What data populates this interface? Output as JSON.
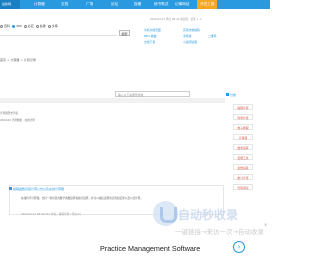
{
  "nav": {
    "logo": "最新网",
    "items": [
      "计算器",
      "文档",
      "广场",
      "论坛",
      "投稿",
      "秘书笔试",
      "记事网站",
      "开发工具"
    ]
  },
  "search": {
    "options": [
      "百科",
      "360",
      "必应",
      "谷歌",
      "文库"
    ],
    "selected_index": 1,
    "button": "搜索"
  },
  "header": {
    "userline": "2020-04-12 周日 08:40  欢迎您：某某  +  ×",
    "links": [
      "手机文档页面",
      "实用文档编辑",
      "MP3 歌曲",
      "手机版",
      "文档下载",
      "小说阅读器",
      "二维码"
    ]
  },
  "breadcrumb": "首页 > 计算器 > 计算记录",
  "main_input_placeholder": "输入以下关键字查询",
  "faint_lines": [
    "计算器历史列表",
    "2020-04 计算数据 · 在线计算"
  ],
  "sidebar": {
    "heading": "分类",
    "items": [
      "编程计算",
      "科学计算",
      "电子教程",
      "计算器",
      "数学运算",
      "宝图工具",
      "复数运算",
      "统计计算",
      "代码调试"
    ]
  },
  "card": {
    "title": "编程函数高级计算公式以及在线计算器",
    "desc": "在线科学计算器，支持一些常见的数学函数运算和统计运算，并可以输出运算的过程和结果以及公式计算。",
    "meta": "2020-04-12 08:40:33 | 作者：编程计算 | 评论(0)"
  },
  "ad": {
    "title": "Practice Management Software",
    "close": "×",
    "arrow": "›"
  },
  "watermark": {
    "text": "自动秒收录",
    "sub": "一键链接→来访一次→自动收录"
  },
  "colors": {
    "brand": "#2a9ae0",
    "accent": "#f5a623",
    "sidebar_text": "#e0543f"
  }
}
